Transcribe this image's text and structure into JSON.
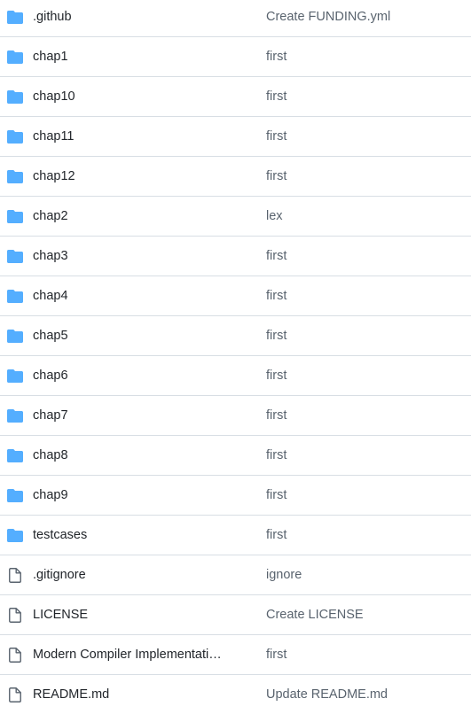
{
  "colors": {
    "folder_icon": "#54aeff",
    "file_icon": "#59636e",
    "name_text": "#1f2328",
    "commit_text": "#59636e",
    "divider": "#d8dee4"
  },
  "files": [
    {
      "type": "folder",
      "icon": "folder-icon",
      "name": ".github",
      "commit": "Create FUNDING.yml"
    },
    {
      "type": "folder",
      "icon": "folder-icon",
      "name": "chap1",
      "commit": "first"
    },
    {
      "type": "folder",
      "icon": "folder-icon",
      "name": "chap10",
      "commit": "first"
    },
    {
      "type": "folder",
      "icon": "folder-icon",
      "name": "chap11",
      "commit": "first"
    },
    {
      "type": "folder",
      "icon": "folder-icon",
      "name": "chap12",
      "commit": "first"
    },
    {
      "type": "folder",
      "icon": "folder-icon",
      "name": "chap2",
      "commit": "lex"
    },
    {
      "type": "folder",
      "icon": "folder-icon",
      "name": "chap3",
      "commit": "first"
    },
    {
      "type": "folder",
      "icon": "folder-icon",
      "name": "chap4",
      "commit": "first"
    },
    {
      "type": "folder",
      "icon": "folder-icon",
      "name": "chap5",
      "commit": "first"
    },
    {
      "type": "folder",
      "icon": "folder-icon",
      "name": "chap6",
      "commit": "first"
    },
    {
      "type": "folder",
      "icon": "folder-icon",
      "name": "chap7",
      "commit": "first"
    },
    {
      "type": "folder",
      "icon": "folder-icon",
      "name": "chap8",
      "commit": "first"
    },
    {
      "type": "folder",
      "icon": "folder-icon",
      "name": "chap9",
      "commit": "first"
    },
    {
      "type": "folder",
      "icon": "folder-icon",
      "name": "testcases",
      "commit": "first"
    },
    {
      "type": "file",
      "icon": "file-icon",
      "name": ".gitignore",
      "commit": "ignore"
    },
    {
      "type": "file",
      "icon": "file-icon",
      "name": "LICENSE",
      "commit": "Create LICENSE"
    },
    {
      "type": "file",
      "icon": "file-icon",
      "name": "Modern Compiler Implementati…",
      "commit": "first"
    },
    {
      "type": "file",
      "icon": "file-icon",
      "name": "README.md",
      "commit": "Update README.md"
    }
  ]
}
